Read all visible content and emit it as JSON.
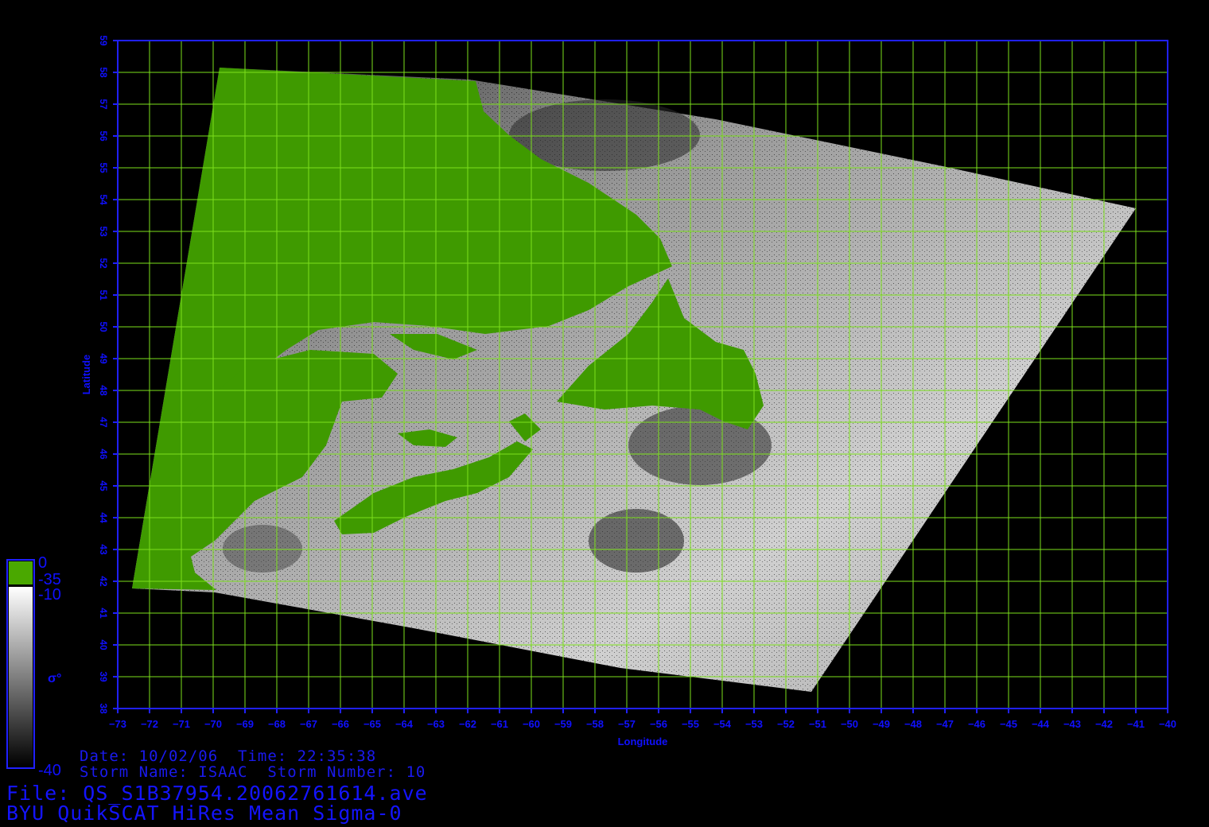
{
  "map": {
    "lon_range": [
      -73,
      -40
    ],
    "lat_range": [
      38,
      59
    ],
    "lon_ticks": [
      -73,
      -72,
      -71,
      -70,
      -69,
      -68,
      -67,
      -66,
      -65,
      -64,
      -63,
      -62,
      -61,
      -60,
      -59,
      -58,
      -57,
      -56,
      -55,
      -54,
      -53,
      -52,
      -51,
      -50,
      -49,
      -48,
      -47,
      -46,
      -45,
      -44,
      -43,
      -42,
      -41,
      -40
    ],
    "lat_ticks": [
      38,
      39,
      40,
      41,
      42,
      43,
      44,
      45,
      46,
      47,
      48,
      49,
      50,
      51,
      52,
      53,
      54,
      55,
      56,
      57,
      58,
      59
    ],
    "xlabel": "Longitude",
    "ylabel": "Latitude",
    "grid": true,
    "colors": {
      "axis": "#2020ff",
      "grid": "#7ce01c",
      "land": "#3f9a00",
      "background": "#000000"
    }
  },
  "colorbar": {
    "label": "σ°",
    "land_range_labels": [
      "0",
      "-35"
    ],
    "ocean_range_labels": [
      "-10",
      "-40"
    ],
    "land_color": "#4aa800",
    "ocean_gradient": [
      "#ffffff",
      "#000000"
    ]
  },
  "info": {
    "date_time": "Date: 10/02/06  Time: 22:35:38",
    "storm": "Storm Name: ISAAC  Storm Number: 10",
    "file": "File: QS_S1B37954.20062761614.ave",
    "product": "BYU QuikSCAT HiRes Mean Sigma-0"
  }
}
